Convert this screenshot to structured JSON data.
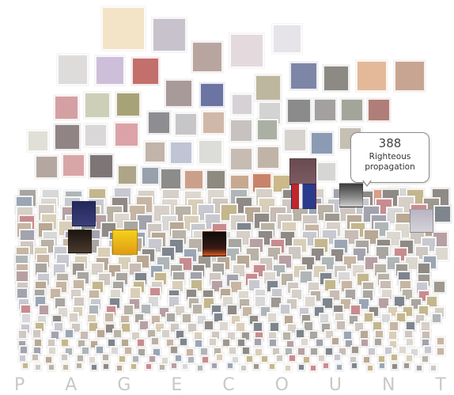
{
  "x_axis_label": "PAGECOUNT",
  "tooltip": {
    "value": "388",
    "title": "Righteous propagation"
  }
}
